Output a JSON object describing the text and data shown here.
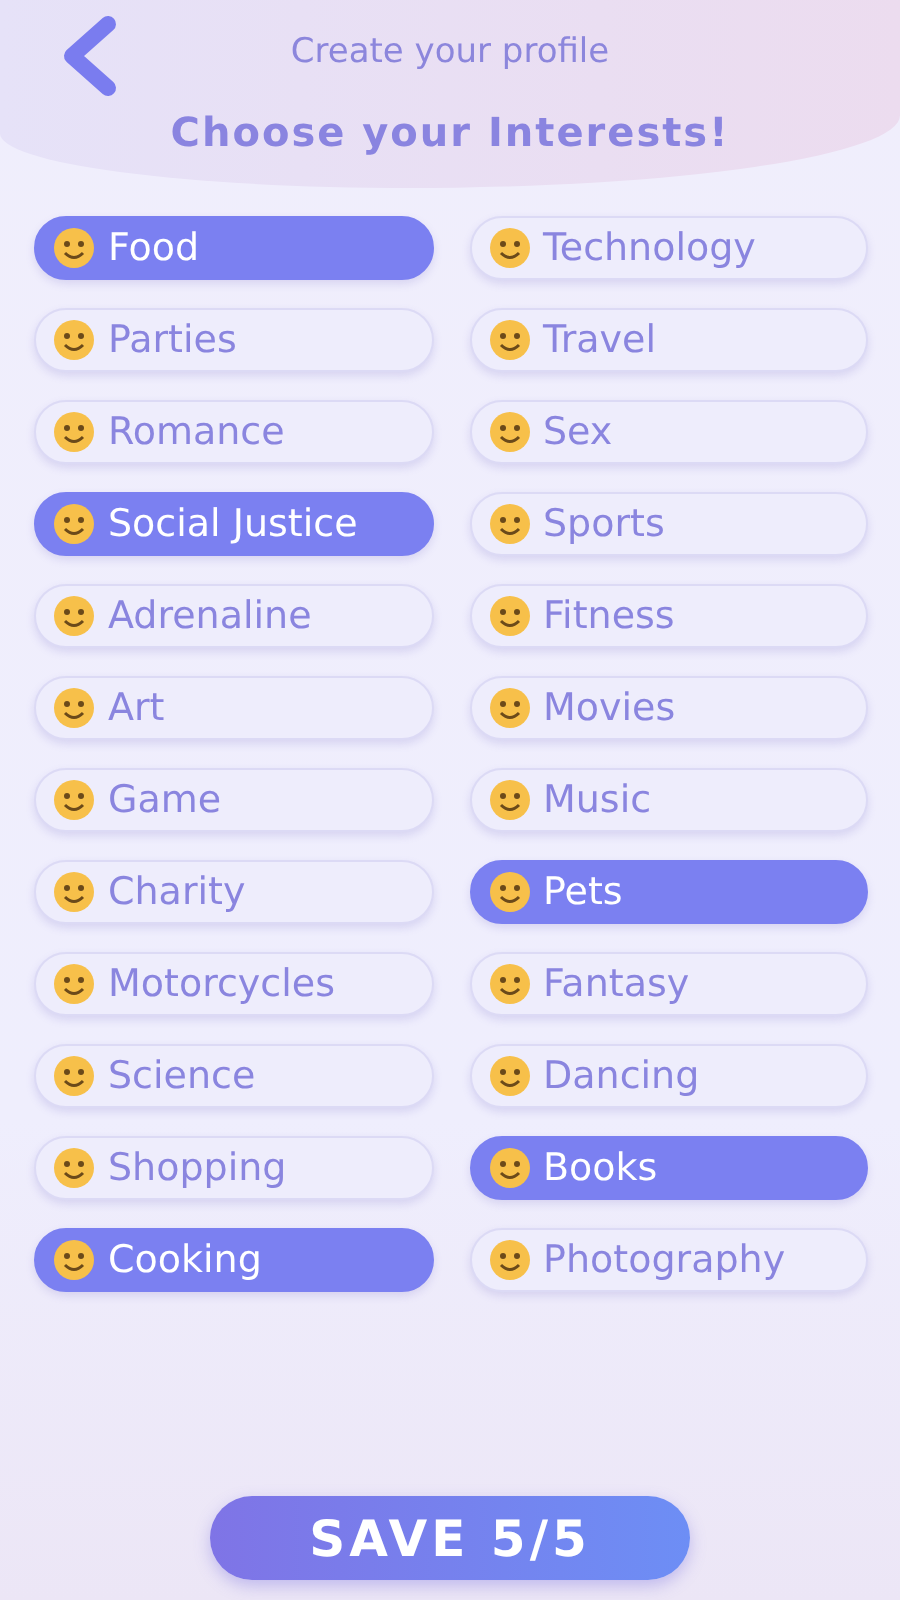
{
  "header": {
    "subtitle": "Create your profile",
    "title": "Choose your Interests!"
  },
  "interests": [
    {
      "label": "Food",
      "selected": true
    },
    {
      "label": "Technology",
      "selected": false
    },
    {
      "label": "Parties",
      "selected": false
    },
    {
      "label": "Travel",
      "selected": false
    },
    {
      "label": "Romance",
      "selected": false
    },
    {
      "label": "Sex",
      "selected": false
    },
    {
      "label": "Social Justice",
      "selected": true
    },
    {
      "label": "Sports",
      "selected": false
    },
    {
      "label": "Adrenaline",
      "selected": false
    },
    {
      "label": "Fitness",
      "selected": false
    },
    {
      "label": "Art",
      "selected": false
    },
    {
      "label": "Movies",
      "selected": false
    },
    {
      "label": "Game",
      "selected": false
    },
    {
      "label": "Music",
      "selected": false
    },
    {
      "label": "Charity",
      "selected": false
    },
    {
      "label": "Pets",
      "selected": true
    },
    {
      "label": "Motorcycles",
      "selected": false
    },
    {
      "label": "Fantasy",
      "selected": false
    },
    {
      "label": "Science",
      "selected": false
    },
    {
      "label": "Dancing",
      "selected": false
    },
    {
      "label": "Shopping",
      "selected": false
    },
    {
      "label": "Books",
      "selected": true
    },
    {
      "label": "Cooking",
      "selected": true
    },
    {
      "label": "Photography",
      "selected": false
    }
  ],
  "save_button": "SAVE 5/5"
}
